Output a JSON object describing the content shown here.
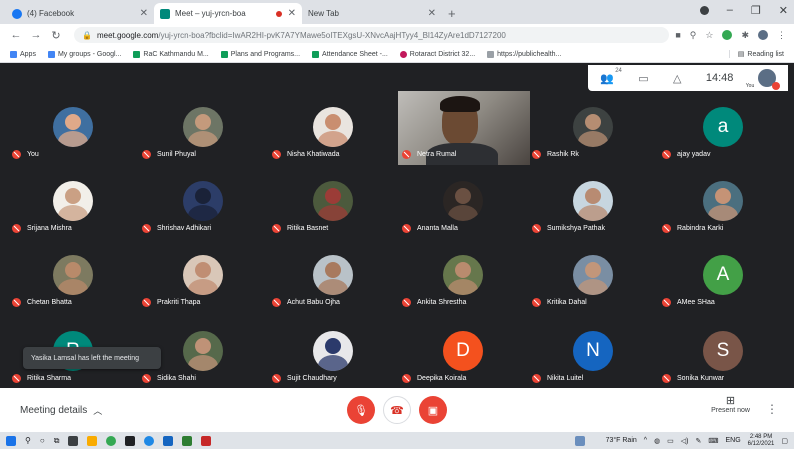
{
  "browser": {
    "tabs": [
      {
        "label": "(4) Facebook",
        "favicon_color": "#1877f2",
        "active": false
      },
      {
        "label": "Meet – yuj-yrcn-boa",
        "favicon_color": "#00897b",
        "active": true
      },
      {
        "label": "New Tab",
        "favicon_color": "",
        "active": false
      }
    ],
    "url_host": "meet.google.com",
    "url_path": "/yuj-yrcn-boa?fbclid=IwAR2HI-pvK7A7YMawe5oITEXgsU-XNvcAajHTyy4_Bl14ZyAre1dD7127200",
    "bookmarks": [
      {
        "label": "Apps",
        "color": "#4285f4"
      },
      {
        "label": "My groups - Googl...",
        "color": "#4285f4"
      },
      {
        "label": "RaC Kathmandu M...",
        "color": "#0f9d58"
      },
      {
        "label": "Plans and Programs...",
        "color": "#0f9d58"
      },
      {
        "label": "Attendance Sheet -...",
        "color": "#0f9d58"
      },
      {
        "label": "Rotaract District 32...",
        "color": "#c2185b"
      },
      {
        "label": "https://publichealth...",
        "color": "#9aa0a6"
      }
    ],
    "reading_list": "Reading list"
  },
  "meet": {
    "participant_count": "24",
    "time": "14:48",
    "self_label": "You",
    "participants": [
      {
        "name": "You",
        "initial": "",
        "color": "#3f6fa0",
        "skin": "#e0a989"
      },
      {
        "name": "Sunil Phuyal",
        "initial": "",
        "color": "#6d7565",
        "skin": "#c49a7c"
      },
      {
        "name": "Nisha Khatiwada",
        "initial": "",
        "color": "#e9e4df",
        "skin": "#c98e70"
      },
      {
        "name": "Netra Rumal",
        "initial": "",
        "color": "",
        "skin": "",
        "video": true
      },
      {
        "name": "Rashik Rk",
        "initial": "",
        "color": "#3d4241",
        "skin": "#b58d72"
      },
      {
        "name": "ajay yadav",
        "initial": "a",
        "color": "#00897b"
      },
      {
        "name": "Srijana Mishra",
        "initial": "",
        "color": "#f2efe9",
        "skin": "#caa084"
      },
      {
        "name": "Shrishav Adhikari",
        "initial": "",
        "color": "#2c3d68",
        "skin": "#1a2238"
      },
      {
        "name": "Ritika Basnet",
        "initial": "",
        "color": "#4c5a3d",
        "skin": "#9b3c37"
      },
      {
        "name": "Ananta Malla",
        "initial": "",
        "color": "#2b2624",
        "skin": "#6a5042"
      },
      {
        "name": "Sumikshya Pathak",
        "initial": "",
        "color": "#c7d6e0",
        "skin": "#b88b72"
      },
      {
        "name": "Rabindra Karki",
        "initial": "",
        "color": "#4b6f7f",
        "skin": "#c59376"
      },
      {
        "name": "Chetan Bhatta",
        "initial": "",
        "color": "#7d7a60",
        "skin": "#b88a6a"
      },
      {
        "name": "Prakriti Thapa",
        "initial": "",
        "color": "#d9c7b8",
        "skin": "#c08e73"
      },
      {
        "name": "Achut Babu Ojha",
        "initial": "",
        "color": "#b9c2c8",
        "skin": "#a87a5e"
      },
      {
        "name": "Ankita Shrestha",
        "initial": "",
        "color": "#66774c",
        "skin": "#b98b6e"
      },
      {
        "name": "Kritika Dahal",
        "initial": "",
        "color": "#7a8ea3",
        "skin": "#c2967a"
      },
      {
        "name": "AMee SHaa",
        "initial": "A",
        "color": "#43a047"
      },
      {
        "name": "Ritika Sharma",
        "initial": "R",
        "color": "#00897b"
      },
      {
        "name": "Sidika Shahi",
        "initial": "",
        "color": "#56694b",
        "skin": "#bf9277"
      },
      {
        "name": "Sujit Chaudhary",
        "initial": "",
        "color": "#e8e8ea",
        "skin": "#2b3a6b"
      },
      {
        "name": "Deepika Koirala",
        "initial": "D",
        "color": "#f4511e"
      },
      {
        "name": "Nikita Luitel",
        "initial": "N",
        "color": "#1565c0"
      },
      {
        "name": "Sonika Kunwar",
        "initial": "S",
        "color": "#795548"
      }
    ],
    "toast": "Yasika Lamsal has left the meeting",
    "meeting_details": "Meeting details",
    "present_now": "Present now"
  },
  "taskbar": {
    "weather": "73°F  Rain",
    "lang": "ENG",
    "time": "2:48 PM",
    "date": "6/12/2021"
  },
  "colors": {
    "accent_red": "#ea4335",
    "bg_dark": "#202124"
  }
}
